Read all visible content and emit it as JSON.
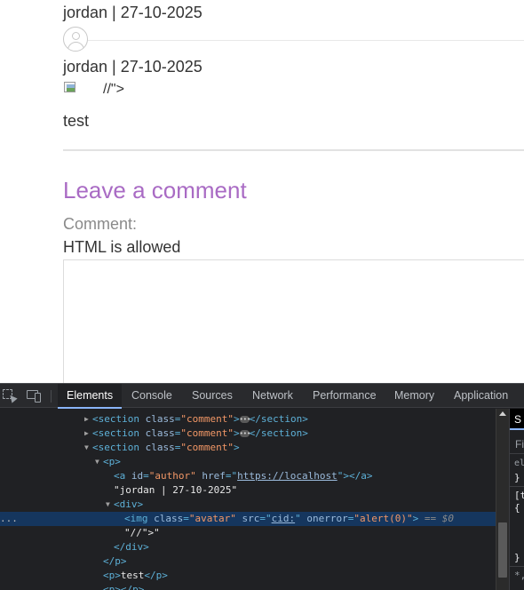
{
  "comments": {
    "first_meta": "jordan | 27-10-2025",
    "second_meta": "jordan | 27-10-2025",
    "broken_img_trailing_text": "//\">",
    "second_body": "test"
  },
  "form": {
    "heading": "Leave a comment",
    "comment_label": "Comment:",
    "html_hint": "HTML is allowed",
    "comment_value": ""
  },
  "devtools": {
    "tabs": [
      {
        "label": "Elements",
        "active": true
      },
      {
        "label": "Console",
        "active": false
      },
      {
        "label": "Sources",
        "active": false
      },
      {
        "label": "Network",
        "active": false
      },
      {
        "label": "Performance",
        "active": false
      },
      {
        "label": "Memory",
        "active": false
      },
      {
        "label": "Application",
        "active": false
      }
    ],
    "dom": {
      "section_tag": "section",
      "class_attr": "class",
      "comment_class": "\"comment\"",
      "p_tag": "p",
      "a_tag": "a",
      "id_attr": "id",
      "author_id": "\"author\"",
      "href_attr": "href",
      "href_value": "https://localhost",
      "author_text": "\"jordan | 27-10-2025\"",
      "div_tag": "div",
      "img_tag": "img",
      "avatar_class": "\"avatar\"",
      "src_attr": "src",
      "src_value": "cid:",
      "onerror_attr": "onerror",
      "onerror_value": "\"alert(0)\"",
      "selected_marker": "== $0",
      "stray_text": "\"//\">\"",
      "p_text": "test",
      "side_marker": "..."
    },
    "styles_pane": {
      "tab_label": "S",
      "filter_label": "Fi",
      "element_style": "el",
      "brace_close": "}",
      "rule_selector": "[t",
      "brace_open": "{",
      "brace_close_2": "}",
      "rule_tail": "*,"
    }
  }
}
